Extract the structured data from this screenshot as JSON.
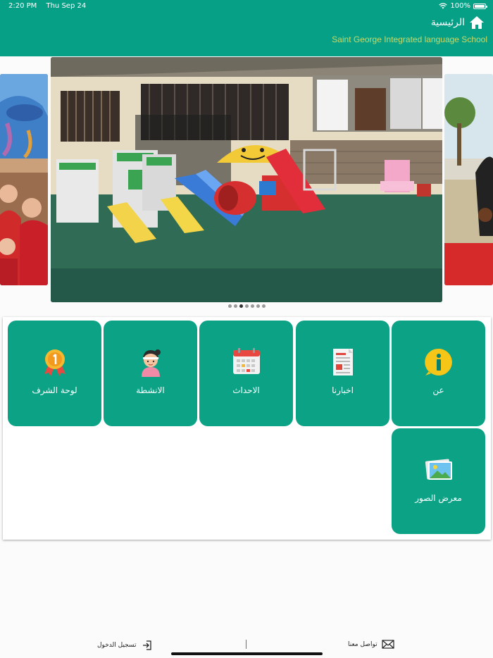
{
  "status_bar": {
    "time": "2:20 PM",
    "date": "Thu Sep 24",
    "battery": "100%"
  },
  "header": {
    "title": "الرئيسية",
    "subtitle": "Saint George Integrated language School"
  },
  "carousel": {
    "slide_count": 7,
    "active_index": 2
  },
  "menu": {
    "items": [
      {
        "label": "عن",
        "icon": "info-icon"
      },
      {
        "label": "اخبارنا",
        "icon": "news-icon"
      },
      {
        "label": "الاحداث",
        "icon": "calendar-icon"
      },
      {
        "label": "الانشطة",
        "icon": "activities-icon"
      },
      {
        "label": "لوحة الشرف",
        "icon": "medal-icon"
      },
      {
        "label": "معرض الصور",
        "icon": "gallery-icon"
      }
    ]
  },
  "bottom_bar": {
    "login_label": "تسجيل الدخول",
    "contact_label": "تواصل معنا"
  },
  "colors": {
    "primary": "#05a086",
    "tile": "#0ba285",
    "subtitle": "#c8d96a"
  }
}
